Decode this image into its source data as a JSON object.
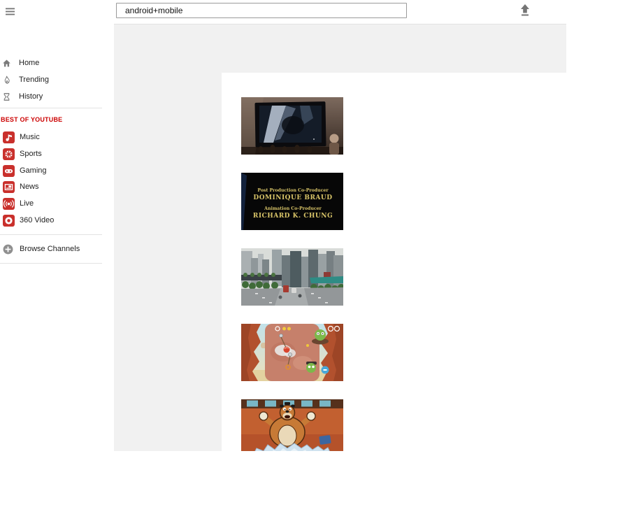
{
  "topbar": {
    "search_value": "android+mobile"
  },
  "sidebar": {
    "main_items": [
      {
        "label": "Home"
      },
      {
        "label": "Trending"
      },
      {
        "label": "History"
      }
    ],
    "section_title": "BEST OF YOUTUBE",
    "best_items": [
      {
        "label": "Music"
      },
      {
        "label": "Sports"
      },
      {
        "label": "Gaming"
      },
      {
        "label": "News"
      },
      {
        "label": "Live"
      },
      {
        "label": "360 Video"
      }
    ],
    "browse_label": "Browse Channels"
  },
  "content": {
    "thumbnails": [
      {
        "name": "tv-screen-in-dark-room"
      },
      {
        "name": "movie-end-credits",
        "credits": {
          "line1": "Post Production Co-Producer",
          "line2": "DOMINIQUE BRAUD",
          "line3": "Animation Co-Producer",
          "line4": "RICHARD K. CHUNG"
        }
      },
      {
        "name": "city-street-skyscrapers"
      },
      {
        "name": "cut-the-rope-game-level"
      },
      {
        "name": "cartoon-character-in-ice"
      }
    ]
  },
  "colors": {
    "accent_red": "#cc0000",
    "content_bg": "#f1f1f1",
    "topbar_border": "#e2e2e2"
  }
}
